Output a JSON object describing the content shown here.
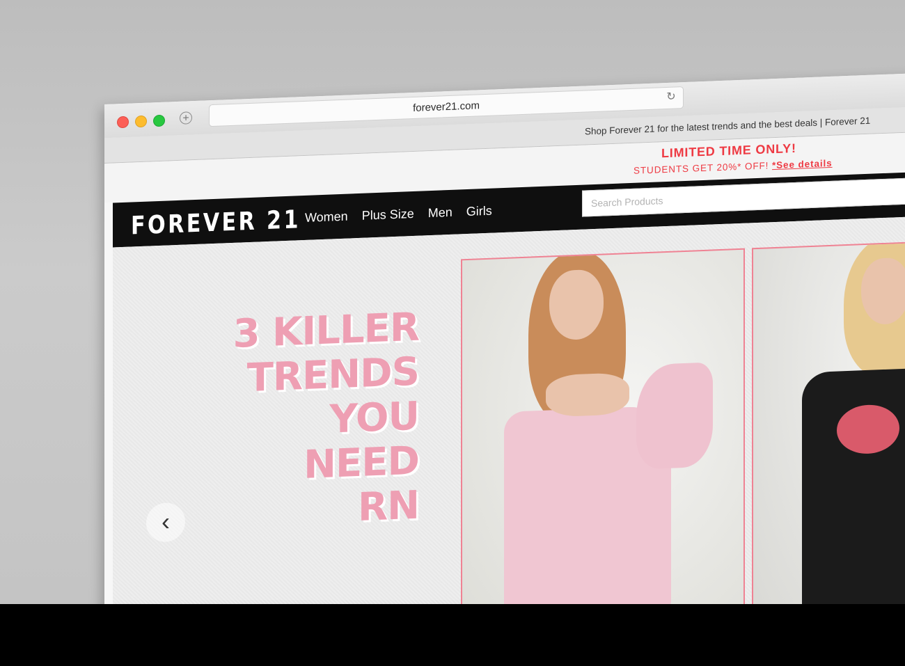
{
  "browser": {
    "url": "forever21.com",
    "page_title": "Shop Forever 21 for the latest trends and the best deals | Forever 21"
  },
  "promo": {
    "headline": "LIMITED TIME ONLY!",
    "subtext": "STUDENTS GET 20%* OFF!",
    "link": "*See details"
  },
  "header": {
    "logo": "FOREVER 21",
    "nav": [
      "Women",
      "Plus Size",
      "Men",
      "Girls"
    ],
    "search_placeholder": "Search Products"
  },
  "hero": {
    "headline_lines": [
      "3 KILLER",
      "TRENDS",
      "YOU",
      "NEED",
      "RN"
    ]
  },
  "colors": {
    "promo_red": "#ee3a43",
    "headline_pink": "#ee9fb3",
    "panel_border": "#ef8293",
    "nav_bg": "#0f0f0f"
  },
  "icons": {
    "close": "red-circle",
    "minimize": "yellow-circle",
    "zoom": "green-circle",
    "new_tab": "plus-circle",
    "reload": "reload-arrow",
    "previous": "chevron-left"
  }
}
